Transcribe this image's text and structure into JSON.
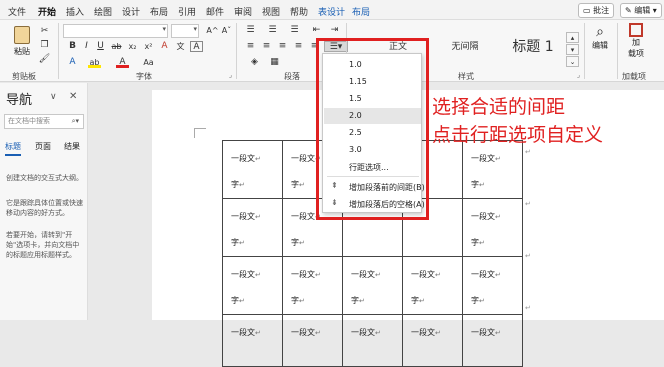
{
  "menubar": {
    "tabs": [
      "文件",
      "开始",
      "插入",
      "绘图",
      "设计",
      "布局",
      "引用",
      "邮件",
      "审阅",
      "视图",
      "帮助",
      "表设计",
      "布局"
    ],
    "active_tab": "开始",
    "comment_button": "批注",
    "edit_button": "编辑"
  },
  "ribbon": {
    "clipboard": {
      "paste_label": "粘贴",
      "group_label": "剪贴板"
    },
    "font": {
      "group_label": "字体",
      "font_name": "",
      "font_size": "",
      "bold": "B",
      "italic": "I",
      "underline": "U",
      "strike": "ab",
      "sub": "x₂",
      "sup": "x²",
      "clear": "A",
      "highlight": "ab",
      "color": "A",
      "grow": "A^",
      "shrink": "Aˇ",
      "case": "Aa",
      "phonetic": "文",
      "border": "A"
    },
    "paragraph": {
      "group_label": "段落"
    },
    "styles": {
      "group_label": "样式",
      "items": [
        "正文",
        "无间隔",
        "标题 1"
      ]
    },
    "editing": {
      "label": "编辑"
    },
    "addins": {
      "label_line1": "加",
      "label_line2": "载项",
      "group_label": "加载项"
    }
  },
  "nav": {
    "title": "导航",
    "search_placeholder": "在文档中搜索",
    "tabs": [
      "标题",
      "页面",
      "结果"
    ],
    "text1": "创建文档的交互式大纲。",
    "text2": "它是跟踪具体位置或快速移动内容的好方式。",
    "text3": "若要开始，请转到\"开始\"选项卡，并向文档中的标题应用标题样式。"
  },
  "table": {
    "cell_line1": "一段文",
    "cell_line2": "字",
    "rows": 4,
    "cols": 5
  },
  "dropdown": {
    "items": [
      "1.0",
      "1.15",
      "1.5",
      "2.0",
      "2.5",
      "3.0"
    ],
    "highlighted": "2.0",
    "options_label": "行距选项...",
    "add_before": "增加段落前的间距(B)",
    "add_after": "增加段落后的空格(A)"
  },
  "annotation": {
    "line1": "选择合适的间距",
    "line2": "点击行距选项自定义"
  },
  "colors": {
    "accent": "#1a5fb4",
    "annotation": "#e02020"
  }
}
